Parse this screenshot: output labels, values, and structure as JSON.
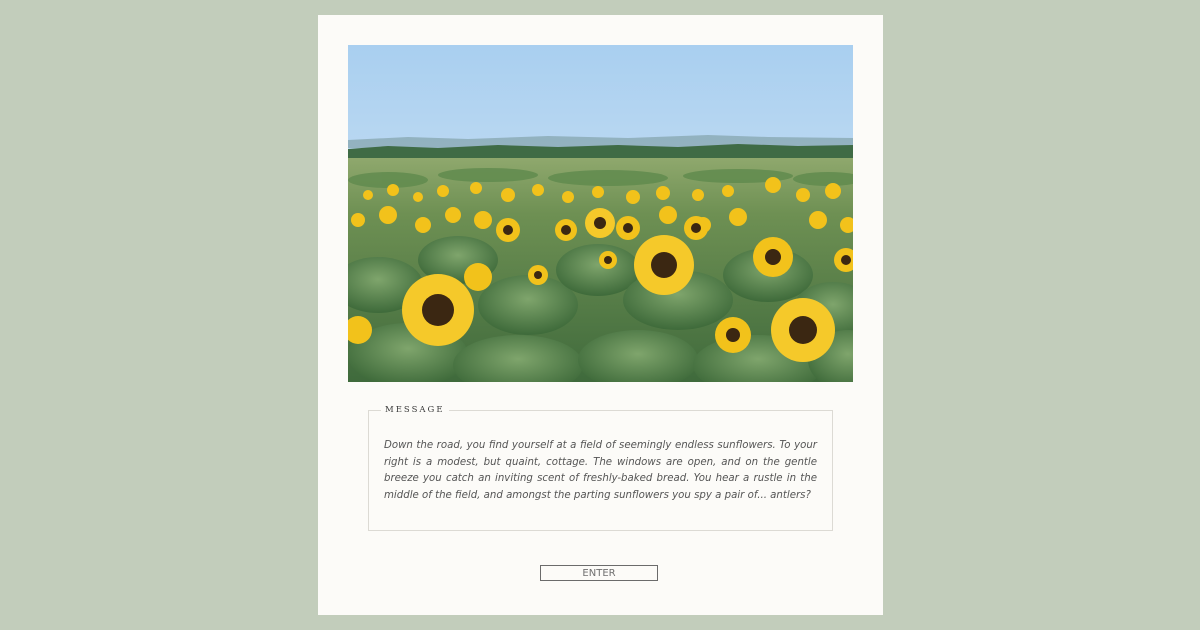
{
  "photo": {
    "subject": "sunflower-field-photo",
    "colors": {
      "sky_top": "#a9cff0",
      "sky_bottom": "#dceaf5",
      "treeline": "#3f6b45",
      "foliage": "#4f7a49",
      "petal": "#f2c21b",
      "center": "#3b2712"
    }
  },
  "message": {
    "legend": "MESSAGE",
    "text": "Down the road, you find yourself at a field of seemingly endless sunflowers. To your right is a modest, but quaint, cottage. The windows are open, and on the gentle breeze you catch an inviting scent of freshly-baked bread. You hear a rustle in the middle of the field, and amongst the parting sunflowers you spy a pair of... antlers?"
  },
  "enter_button": {
    "label": "ENTER"
  },
  "colors": {
    "background": "#c2cdbb",
    "card": "#fcfbf8",
    "border": "#dcdad4",
    "button_border": "#6b6b6b"
  }
}
